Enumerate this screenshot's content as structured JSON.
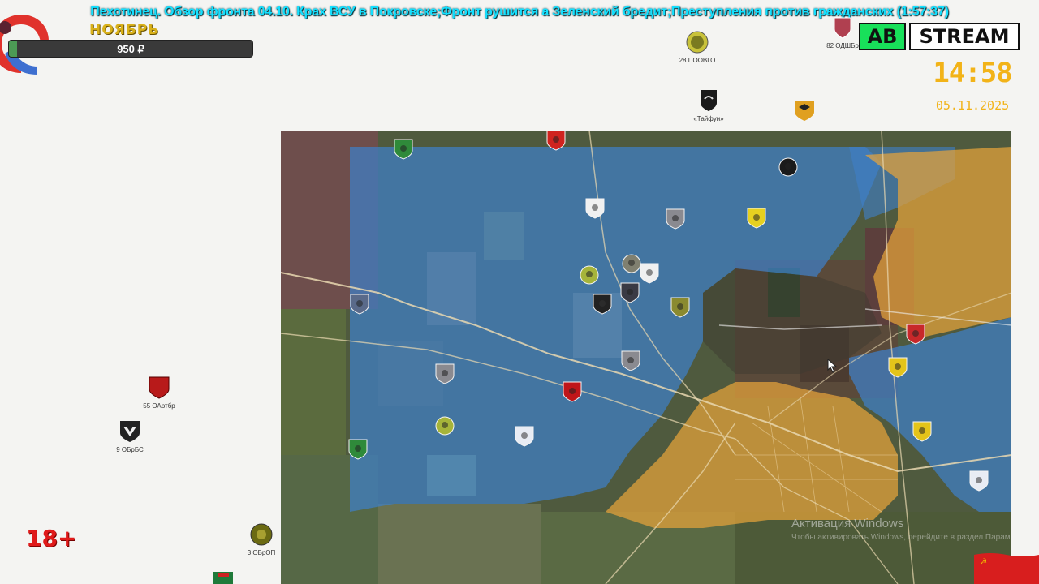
{
  "stream": {
    "title": "Пехотинец. Обзор фронта 04.10. Крах ВСУ в Покровске;Фронт рушится а Зеленский бредит;Преступления против гражданских (1:57:37)",
    "month": "НОЯБРЬ",
    "donation": "950 ₽",
    "logo_left": "AB",
    "logo_right": "STREAM",
    "time": "14:58",
    "date": "05.11.2025",
    "age_rating": "18+"
  },
  "colors": {
    "title": "#14e0ff",
    "clock": "#f2b318",
    "month": "#d9b11a",
    "age": "#e01a1a",
    "map_ukraine_zone": "#3f7fc8",
    "map_russia_zone": "#e6a43a"
  },
  "units_outside": [
    {
      "id": "28-poovgo",
      "label": "28 ПООВГО",
      "icon": "round-green-emblem"
    },
    {
      "id": "82-odshbr",
      "label": "82 ОДШБр",
      "icon": "shield-emblem"
    },
    {
      "id": "taifun",
      "label": "«Тайфун»",
      "icon": "black-shield-emblem"
    },
    {
      "id": "unit-orange",
      "label": "",
      "icon": "orange-shield-emblem"
    },
    {
      "id": "55-oartbr",
      "label": "55 ОАртбр",
      "icon": "red-shield-emblem"
    },
    {
      "id": "9-obrbs",
      "label": "9 ОБрБС",
      "icon": "white-winged-emblem"
    },
    {
      "id": "3-obron",
      "label": "3 ОБрОП",
      "icon": "round-olive-emblem"
    }
  ],
  "units_on_map": [
    {
      "id": "u1",
      "label": "",
      "icon": "green-shield-emblem"
    },
    {
      "id": "u2",
      "label": "",
      "icon": "red-cross-emblem"
    },
    {
      "id": "u3",
      "label": "",
      "icon": "black-red-round-emblem"
    },
    {
      "id": "u4",
      "label": "",
      "icon": "white-shield-emblem"
    },
    {
      "id": "u5",
      "label": "",
      "icon": "grey-emblem"
    },
    {
      "id": "u6",
      "label": "",
      "icon": "yellow-black-emblem"
    },
    {
      "id": "u7",
      "label": "",
      "icon": "green-round-emblem"
    },
    {
      "id": "u8",
      "label": "",
      "icon": "grey-round-emblem"
    },
    {
      "id": "u9",
      "label": "",
      "icon": "white-shield-emblem"
    },
    {
      "id": "u10",
      "label": "",
      "icon": "black-white-emblem"
    },
    {
      "id": "u11",
      "label": "",
      "icon": "olive-emblem"
    },
    {
      "id": "u12",
      "label": "",
      "icon": "trident-emblem"
    },
    {
      "id": "u13",
      "label": "",
      "icon": "dark-emblem"
    },
    {
      "id": "u14",
      "label": "",
      "icon": "red-black-emblem"
    },
    {
      "id": "u15",
      "label": "",
      "icon": "grey-emblem"
    },
    {
      "id": "u16",
      "label": "",
      "icon": "green-round-emblem"
    },
    {
      "id": "u17",
      "label": "",
      "icon": "blue-white-emblem"
    },
    {
      "id": "u18",
      "label": "",
      "icon": "green-shield-emblem"
    },
    {
      "id": "u19",
      "label": "",
      "icon": "red-wing-emblem"
    },
    {
      "id": "u20",
      "label": "",
      "icon": "yellow-lion-emblem"
    },
    {
      "id": "u21",
      "label": "",
      "icon": "grey-emblem"
    },
    {
      "id": "u22",
      "label": "",
      "icon": "yellow-emblem"
    },
    {
      "id": "u23",
      "label": "",
      "icon": "blue-white-emblem"
    }
  ],
  "watermark": {
    "title": "Активация Windows",
    "subtitle": "Чтобы активировать Windows, перейдите в раздел Параметры."
  }
}
